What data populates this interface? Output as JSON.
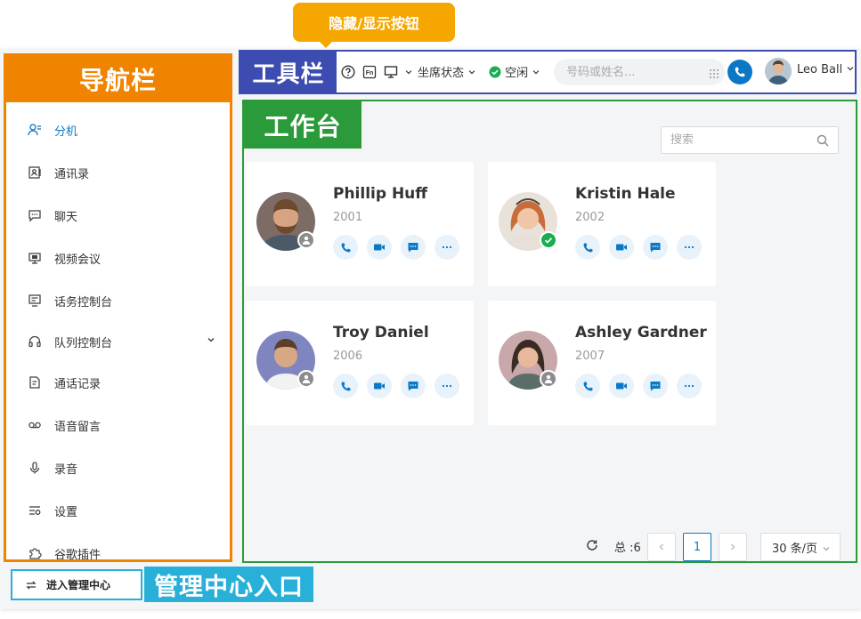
{
  "tooltip": {
    "text": "隐藏/显示按钮"
  },
  "sidebar": {
    "title": "导航栏",
    "items": [
      {
        "label": "分机",
        "icon": "extension-icon",
        "active": true
      },
      {
        "label": "通讯录",
        "icon": "contacts-icon"
      },
      {
        "label": "聊天",
        "icon": "chat-icon"
      },
      {
        "label": "视频会议",
        "icon": "video-conference-icon"
      },
      {
        "label": "话务控制台",
        "icon": "operator-console-icon"
      },
      {
        "label": "队列控制台",
        "icon": "queue-console-icon",
        "expandable": true
      },
      {
        "label": "通话记录",
        "icon": "call-log-icon"
      },
      {
        "label": "语音留言",
        "icon": "voicemail-icon"
      },
      {
        "label": "录音",
        "icon": "microphone-icon"
      },
      {
        "label": "设置",
        "icon": "settings-icon"
      },
      {
        "label": "谷歌插件",
        "icon": "plugin-icon"
      }
    ]
  },
  "admin": {
    "button_label": "进入管理中心",
    "label": "管理中心入口"
  },
  "toolbar": {
    "label": "工具栏",
    "seat_status": "坐席状态",
    "presence": "空闲",
    "dial_placeholder": "号码或姓名...",
    "user_name": "Leo Ball",
    "colors": {
      "accent": "#0a78c6",
      "presence": "#1aad52"
    }
  },
  "workspace": {
    "label": "工作台",
    "search_placeholder": "搜索",
    "cards": [
      {
        "name": "Phillip Huff",
        "ext": "2001",
        "status": "offline"
      },
      {
        "name": "Kristin Hale",
        "ext": "2002",
        "status": "available"
      },
      {
        "name": "Troy Daniel",
        "ext": "2006",
        "status": "offline"
      },
      {
        "name": "Ashley Gardner",
        "ext": "2007",
        "status": "offline"
      }
    ],
    "pagination": {
      "total": "总 :6",
      "current_page": "1",
      "page_size": "30 条/页"
    }
  }
}
